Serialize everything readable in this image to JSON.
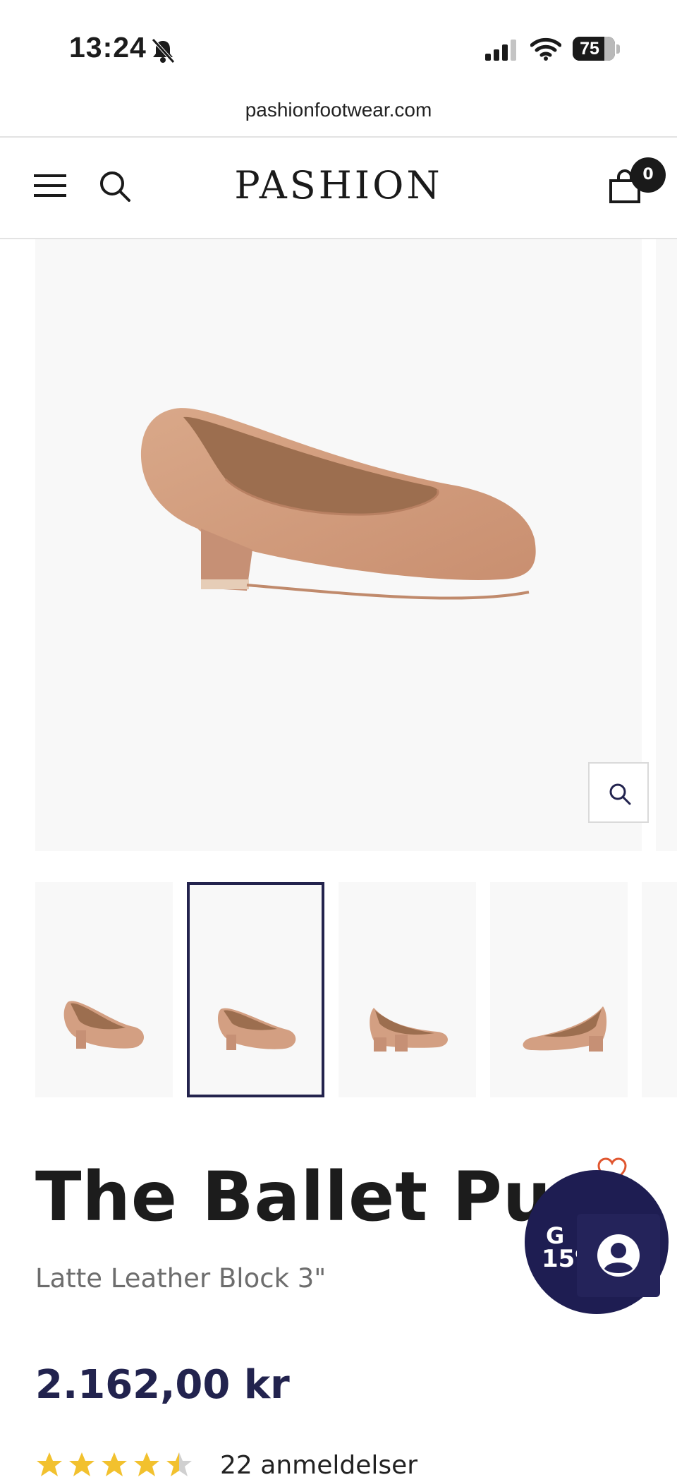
{
  "status_bar": {
    "time": "13:24",
    "battery": "75"
  },
  "browser": {
    "url": "pashionfootwear.com"
  },
  "header": {
    "logo": "PASHION",
    "cart_count": "0"
  },
  "product": {
    "title": "The Ballet Pum",
    "subtitle": "Latte Leather Block 3\"",
    "price": "2.162,00 kr",
    "rating": 4.5,
    "reviews_label": "22 anmeldelser"
  },
  "gallery": {
    "selected_thumbnail": 2,
    "thumbnail_count": 4
  },
  "promo": {
    "line1": "G",
    "line2": "15%"
  },
  "colors": {
    "brand_navy": "#1e1d52",
    "shoe": "#d39f82",
    "accent_heart": "#e0562f"
  }
}
